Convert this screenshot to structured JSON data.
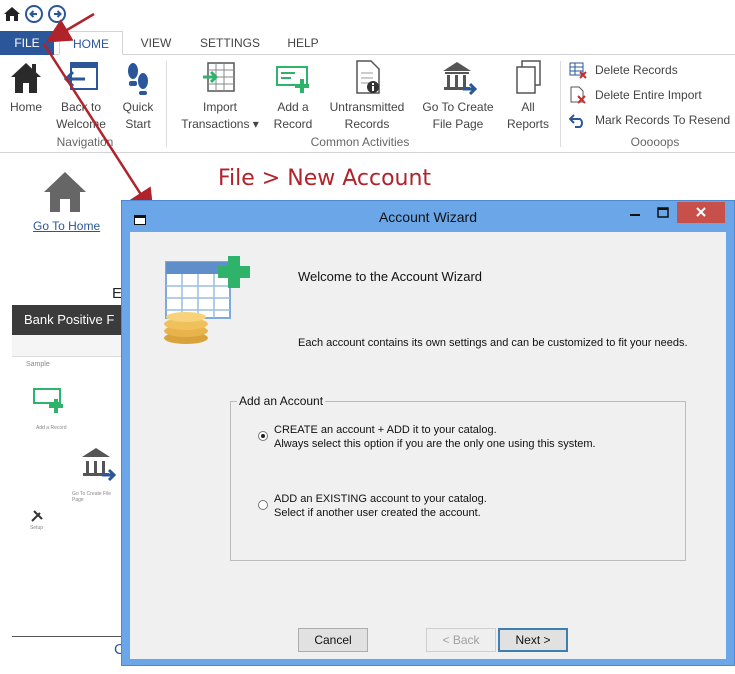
{
  "ribbon": {
    "tabs": [
      "FILE",
      "HOME",
      "VIEW",
      "SETTINGS",
      "HELP"
    ],
    "buttons": {
      "home": "Home",
      "back_to_welcome": "Back to\nWelcome",
      "back_l1": "Back to",
      "back_l2": "Welcome",
      "quick_l1": "Quick",
      "quick_l2": "Start",
      "import_l1": "Import",
      "import_l2": "Transactions ▾",
      "add_l1": "Add a",
      "add_l2": "Record",
      "untrans_l1": "Untransmitted",
      "untrans_l2": "Records",
      "goto_l1": "Go To Create",
      "goto_l2": "File Page",
      "all_l1": "All",
      "all_l2": "Reports"
    },
    "groups": {
      "navigation": "Navigation",
      "common": "Common Activities",
      "other": "Ooooops"
    },
    "small_buttons": {
      "delete_records": "Delete Records",
      "delete_import": "Delete Entire Import",
      "mark_resend": "Mark Records To Resend"
    }
  },
  "background": {
    "go_to_home": "Go To Home",
    "heading_fragment": "E",
    "thumb_title": "Bank Positive F",
    "sample": "Sample",
    "add_record": "Add a Record",
    "go_create": "Go To Create File Page",
    "setup": "Setup",
    "bottom_link": "C"
  },
  "annotation": {
    "text": "File > New Account",
    "color": "#b0232a"
  },
  "dialog": {
    "title": "Account Wizard",
    "welcome": "Welcome to the Account Wizard",
    "description": "Each account contains its own settings and can be customized to fit your needs.",
    "group_label": "Add an Account",
    "options": [
      {
        "label": "CREATE an account + ADD it to your catalog.",
        "hint": "Always select this option if you are the only one using this system.",
        "selected": true
      },
      {
        "label": "ADD an EXISTING account to your catalog.",
        "hint": "Select if another user created the account.",
        "selected": false
      }
    ],
    "buttons": {
      "cancel": "Cancel",
      "back": "< Back",
      "next": "Next >"
    }
  },
  "colors": {
    "file_tab": "#2b579a",
    "dialog_frame": "#6aa6e8",
    "close_button": "#c7504b",
    "accent_green": "#2fb36b"
  }
}
